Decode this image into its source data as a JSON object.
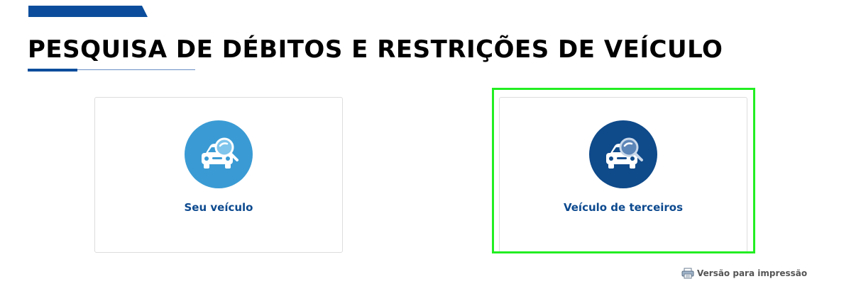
{
  "header": {
    "title": "PESQUISA DE DÉBITOS E RESTRIÇÕES DE VEÍCULO"
  },
  "cards": [
    {
      "label": "Seu veículo",
      "icon": "car-search-icon",
      "color": "#3a9bd4"
    },
    {
      "label": "Veículo de terceiros",
      "icon": "car-search-icon",
      "color": "#0f4a8a"
    }
  ],
  "footer": {
    "print_label": "Versão para impressão",
    "print_icon": "printer-icon"
  },
  "colors": {
    "brand": "#0b4d9c",
    "label": "#0d4a8f",
    "highlight": "#22ee22"
  }
}
